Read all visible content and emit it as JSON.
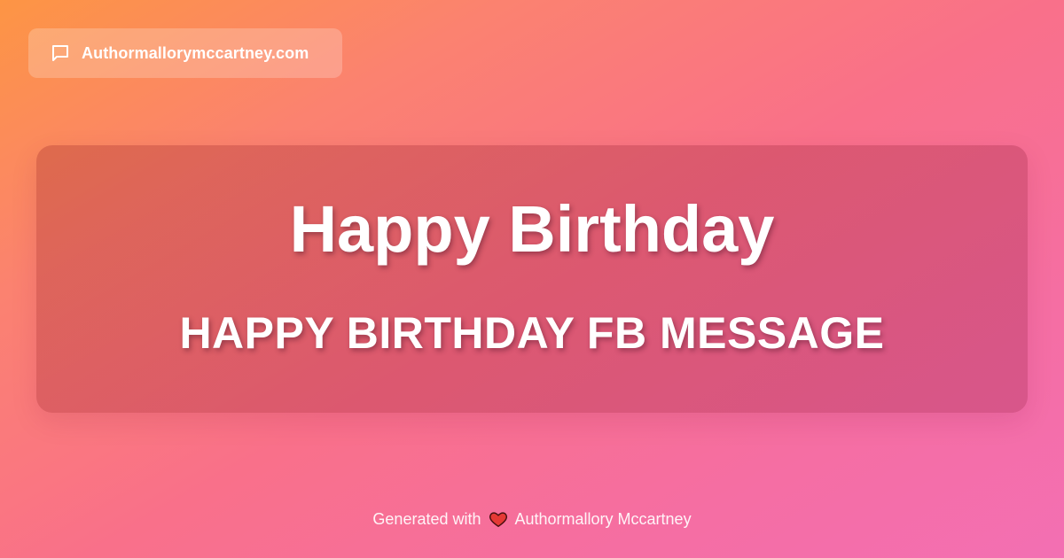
{
  "site": {
    "name": "Authormallorymccartney.com",
    "icon": "chat-bubble-icon"
  },
  "card": {
    "title": "Happy Birthday",
    "subtitle": "HAPPY BIRTHDAY FB MESSAGE"
  },
  "footer": {
    "prefix": "Generated with",
    "icon": "heart-icon",
    "author": "Authormallory Mccartney"
  },
  "colors": {
    "gradient_start": "#fd9544",
    "gradient_mid": "#f9708a",
    "gradient_end": "#f36fb3",
    "heart": "#e53935",
    "text": "#ffffff"
  }
}
